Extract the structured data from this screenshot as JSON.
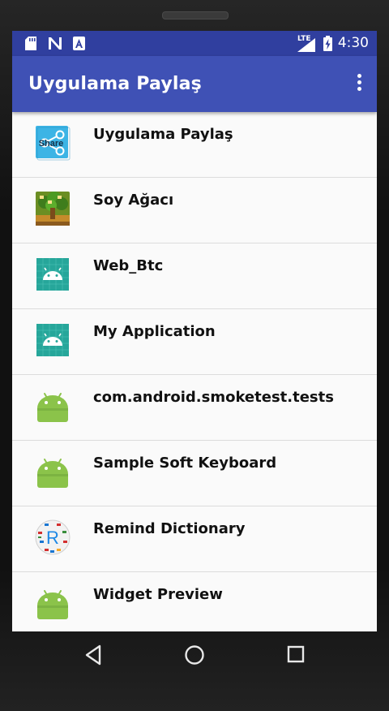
{
  "status_bar": {
    "time": "4:30",
    "network_label": "LTE",
    "left_icons": [
      "sd-card-icon",
      "n-letter-icon",
      "a-letter-icon"
    ],
    "right_icons": [
      "signal-icon",
      "battery-icon"
    ]
  },
  "app_bar": {
    "title": "Uygulama Paylaş",
    "menu_icon": "overflow-menu-icon"
  },
  "apps": [
    {
      "label": "Uygulama Paylaş",
      "icon": "share-app-icon"
    },
    {
      "label": "Soy Ağacı",
      "icon": "family-tree-icon"
    },
    {
      "label": "Web_Btc",
      "icon": "android-teal-icon"
    },
    {
      "label": "My Application",
      "icon": "android-teal-icon"
    },
    {
      "label": "com.android.smoketest.tests",
      "icon": "android-robot-icon"
    },
    {
      "label": "Sample Soft Keyboard",
      "icon": "android-robot-icon"
    },
    {
      "label": "Remind Dictionary",
      "icon": "remind-dictionary-icon"
    },
    {
      "label": "Widget Preview",
      "icon": "android-robot-icon"
    }
  ],
  "icon_texts": {
    "share": "Share",
    "remind": "R"
  },
  "nav_bar": {
    "buttons": [
      "back-icon",
      "home-icon",
      "recents-icon"
    ]
  },
  "colors": {
    "status_bar": "#303f9f",
    "app_bar": "#3f51b5",
    "android_green": "#8bc34a",
    "teal_icon": "#26a69a"
  }
}
